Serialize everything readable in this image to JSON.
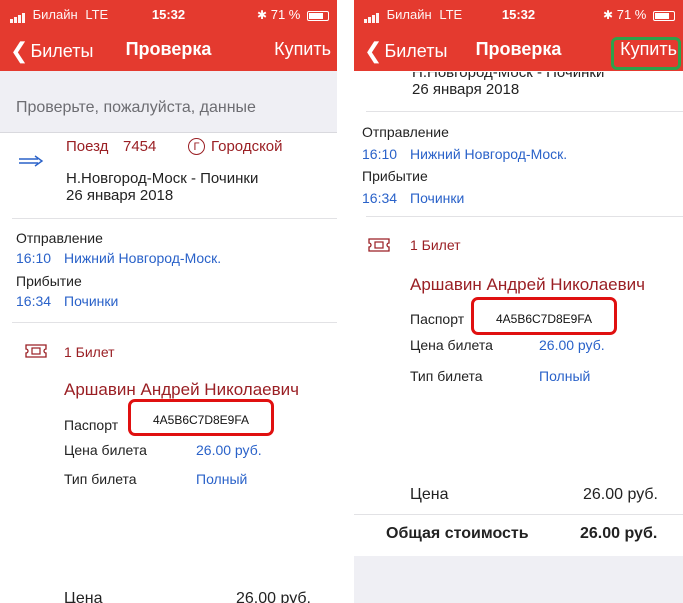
{
  "status_bar": {
    "carrier": "Билайн",
    "network": "LTE",
    "time": "15:32",
    "battery": "71 %"
  },
  "nav": {
    "back_label": "Билеты",
    "title": "Проверка",
    "buy_label": "Купить"
  },
  "hint": "Проверьте, пожалуйста, данные",
  "train": {
    "label": "Поезд",
    "number": "7454",
    "type_badge": "Г",
    "type": "Городской",
    "route": "Н.Новгород-Моск - Починки",
    "date": "26 января 2018"
  },
  "departure": {
    "label": "Отправление",
    "time": "16:10",
    "station": "Нижний Новгород-Моск."
  },
  "arrival": {
    "label": "Прибытие",
    "time": "16:34",
    "station": "Починки"
  },
  "tickets": {
    "count_label": "1 Билет",
    "passenger": "Аршавин Андрей Николаевич",
    "passport_label": "Паспорт",
    "passport_value": "4A5B6C7D8E9FA",
    "price_label": "Цена билета",
    "price_value": "26.00 руб.",
    "type_label": "Тип билета",
    "type_value": "Полный"
  },
  "totals": {
    "price_label": "Цена",
    "price_value": "26.00 руб.",
    "total_label": "Общая стоимость",
    "total_value": "26.00 руб."
  },
  "colors": {
    "nav_red": "#e43a2f",
    "link_blue": "#2a62c9",
    "wine": "#9a1f24",
    "highlight_red": "#e01010",
    "highlight_green": "#2fa14b"
  },
  "icons": [
    "signal-icon",
    "battery-icon",
    "chevron-left-icon",
    "train-arrow-icon",
    "ticket-icon"
  ]
}
